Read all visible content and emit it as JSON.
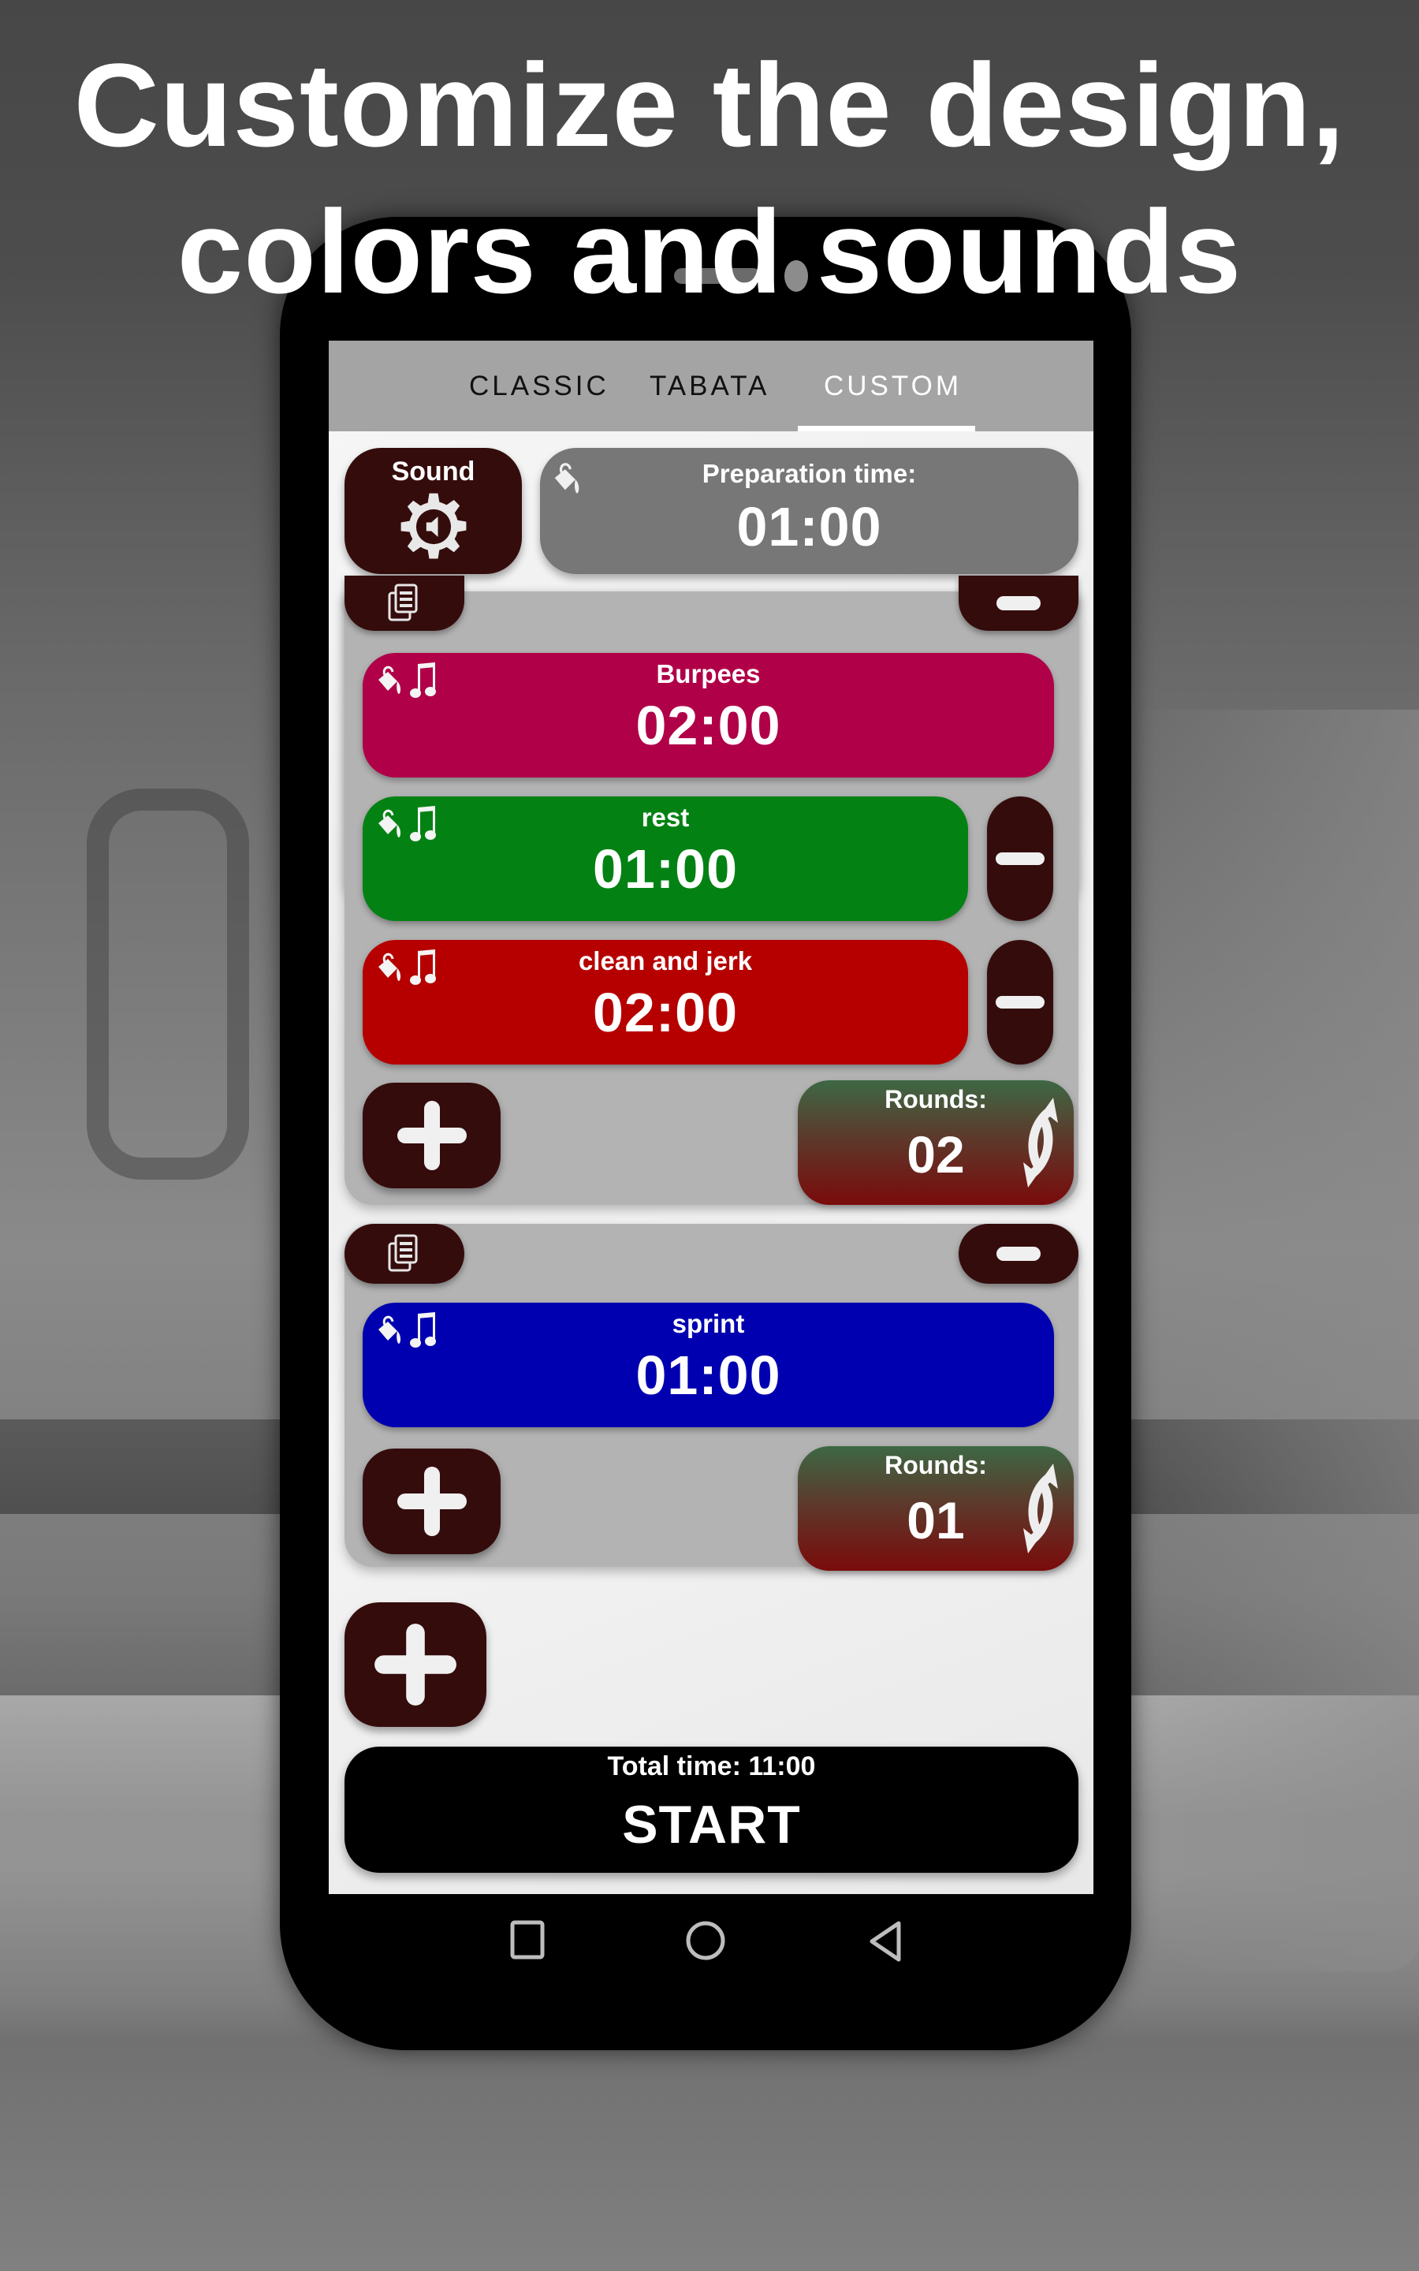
{
  "headline": {
    "line1": "Customize the design,",
    "line2": "colors and sounds"
  },
  "tabs": [
    {
      "label": "CLASSIC",
      "active": false
    },
    {
      "label": "TABATA",
      "active": false
    },
    {
      "label": "CUSTOM",
      "active": true
    }
  ],
  "sound_button": {
    "label": "Sound",
    "icon": "gear-speaker-icon"
  },
  "preparation": {
    "label": "Preparation time:",
    "time": "01:00",
    "color": "#777777",
    "icon": "paint-bucket-icon"
  },
  "groups": [
    {
      "intervals": [
        {
          "name": "Burpees",
          "time": "02:00",
          "color": "#b00048",
          "removable": false
        },
        {
          "name": "rest",
          "time": "01:00",
          "color": "#038213",
          "removable": true
        },
        {
          "name": "clean and jerk",
          "time": "02:00",
          "color": "#b60000",
          "removable": true
        }
      ],
      "rounds_label": "Rounds:",
      "rounds": "02"
    },
    {
      "intervals": [
        {
          "name": "sprint",
          "time": "01:00",
          "color": "#0000b0",
          "removable": false
        }
      ],
      "rounds_label": "Rounds:",
      "rounds": "01"
    }
  ],
  "footer": {
    "total_time": "Total time: 11:00",
    "start_label": "START"
  },
  "colors": {
    "button_dark": "#350c0c",
    "tab_bar": "#a4a4a4",
    "group_bg": "#b3b3b3"
  },
  "navbar": [
    "recents-icon",
    "home-icon",
    "back-icon"
  ]
}
